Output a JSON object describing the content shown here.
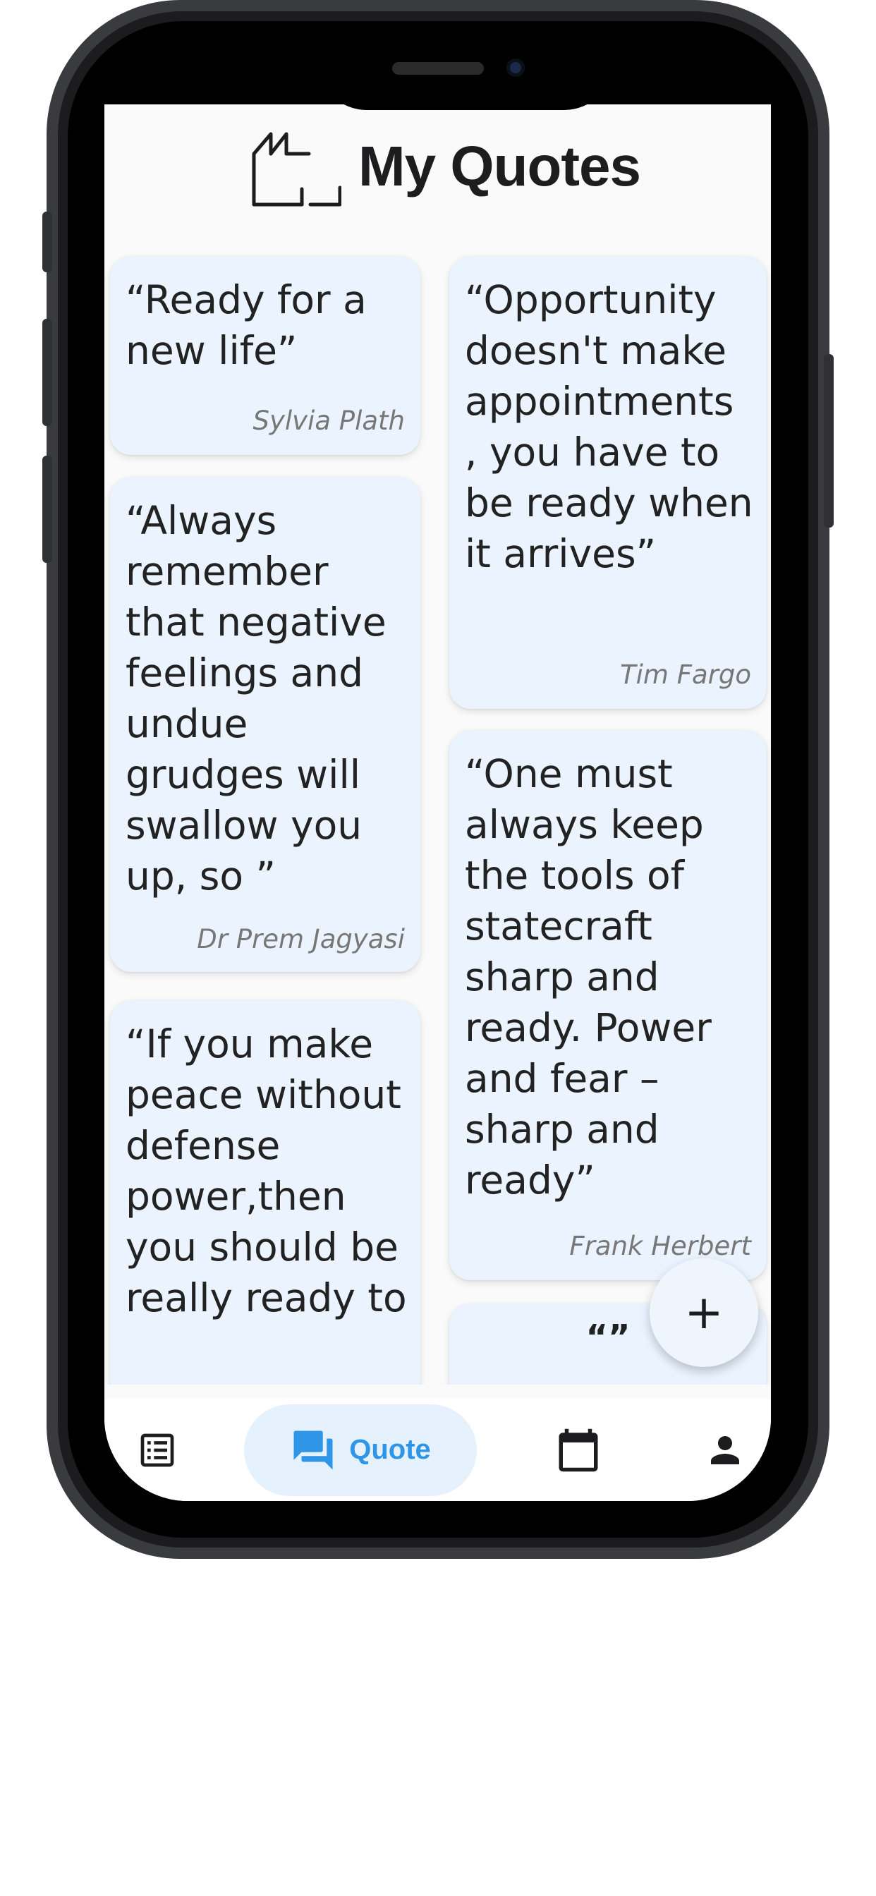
{
  "app": {
    "title": "My Quotes"
  },
  "quotes": [
    {
      "text": "“Ready for a new life”",
      "author": "Sylvia Plath"
    },
    {
      "text": "“Opportunity doesn't make appointments , you have to be ready when it arrives”",
      "author": "Tim Fargo"
    },
    {
      "text": "“Always remember that negative feelings and undue grudges will swallow you up, so ”",
      "author": "Dr Prem Jagyasi"
    },
    {
      "text": "“One must always keep the tools of statecraft sharp and ready. Power and fear – sharp and ready”",
      "author": "Frank Herbert"
    },
    {
      "text": "“If you make peace without defense power,then you should be really ready to",
      "author": ""
    },
    {
      "text": "“”",
      "author": ""
    }
  ],
  "fab": {
    "label": "+"
  },
  "bottom_nav": {
    "items": [
      {
        "icon": "list-icon",
        "label": ""
      },
      {
        "icon": "chat-bubbles-icon",
        "label": "Quote",
        "active": true
      },
      {
        "icon": "calendar-icon",
        "label": ""
      },
      {
        "icon": "person-icon",
        "label": ""
      }
    ]
  },
  "colors": {
    "card_bg": "#eaf3fe",
    "accent": "#2f95e6",
    "active_pill": "#e5f1fc",
    "frame": "#3a3b3f"
  }
}
